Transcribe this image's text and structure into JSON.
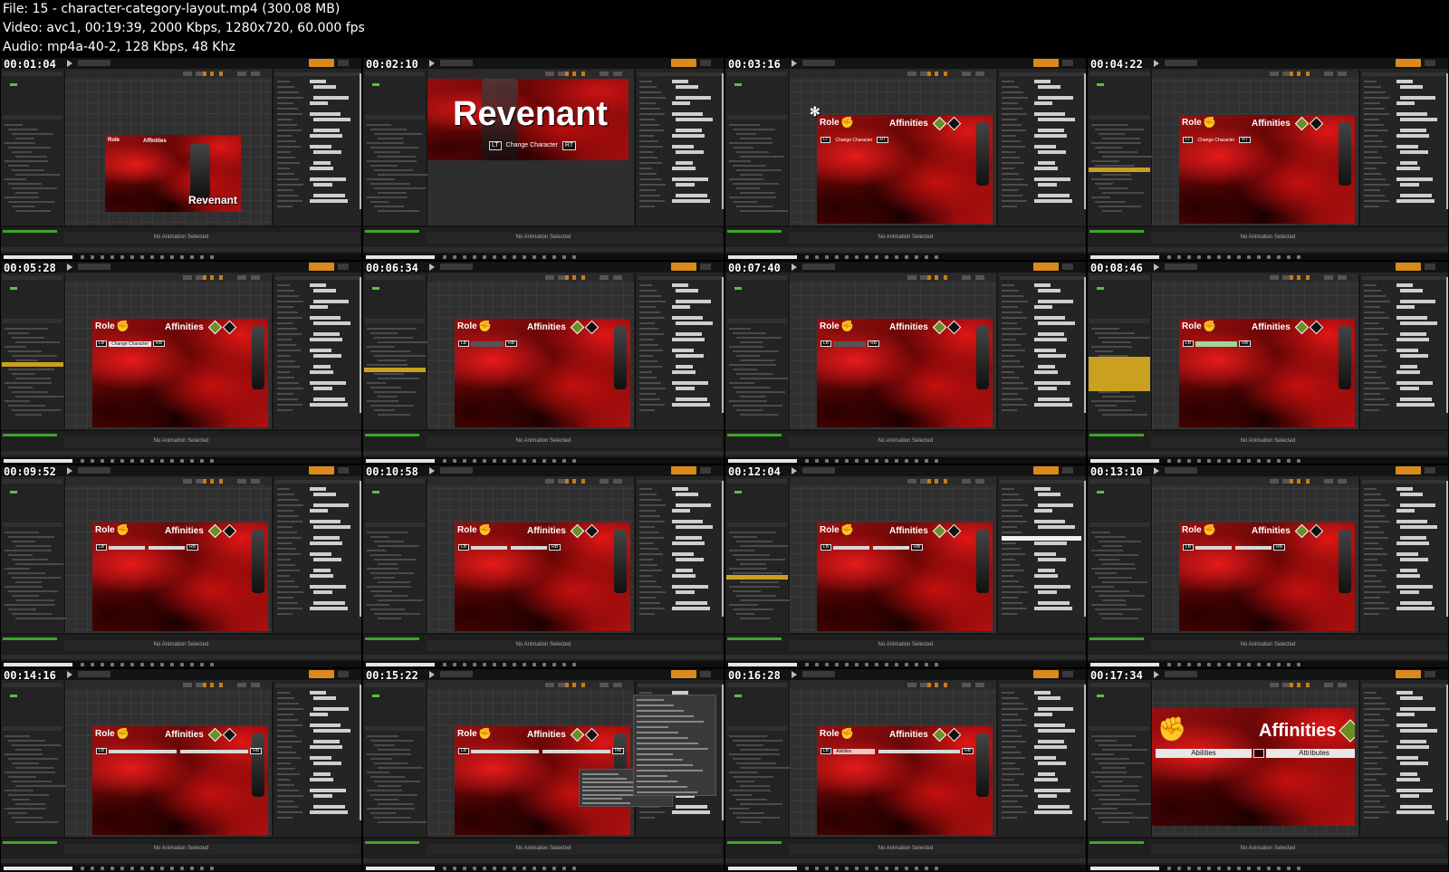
{
  "header": {
    "file_line": "File: 15 - character-category-layout.mp4 (300.08 MB)",
    "video_line": "Video: avc1, 00:19:39, 2000 Kbps, 1280x720, 60.000 fps",
    "audio_line": "Audio: mp4a-40-2, 128 Kbps, 48 Khz"
  },
  "common": {
    "no_animation": "No Animation Selected",
    "role": "Role",
    "affinities": "Affinities",
    "lt": "LT",
    "rt": "RT",
    "lb": "LB",
    "rb": "RB",
    "change_character": "Change Character",
    "revenant": "Revenant",
    "abilities": "Abilities",
    "attributes": "Attributes"
  },
  "cells": [
    {
      "time": "00:01:04",
      "variant": "revenant-small"
    },
    {
      "time": "00:02:10",
      "variant": "revenant-large"
    },
    {
      "time": "00:03:16",
      "variant": "change-char-tree"
    },
    {
      "time": "00:04:22",
      "variant": "change-char-tree2"
    },
    {
      "time": "00:05:28",
      "variant": "lb-change"
    },
    {
      "time": "00:06:34",
      "variant": "lb-dim"
    },
    {
      "time": "00:07:40",
      "variant": "lb-dim2"
    },
    {
      "time": "00:08:46",
      "variant": "lb-green"
    },
    {
      "time": "00:09:52",
      "variant": "lb-wide"
    },
    {
      "time": "00:10:58",
      "variant": "lb-wide2"
    },
    {
      "time": "00:12:04",
      "variant": "lb-wide3"
    },
    {
      "time": "00:13:10",
      "variant": "lb-wide4"
    },
    {
      "time": "00:14:16",
      "variant": "lb-long"
    },
    {
      "time": "00:15:22",
      "variant": "lb-long-dropdown"
    },
    {
      "time": "00:16:28",
      "variant": "lb-abilities"
    },
    {
      "time": "00:17:34",
      "variant": "affinities-zoom"
    }
  ],
  "colors": {
    "designer_accent": "#d98a1a",
    "selection_yellow": "#c9a020",
    "affinity_green": "#6a8e2a",
    "smoke_red": "#c40f0f"
  }
}
